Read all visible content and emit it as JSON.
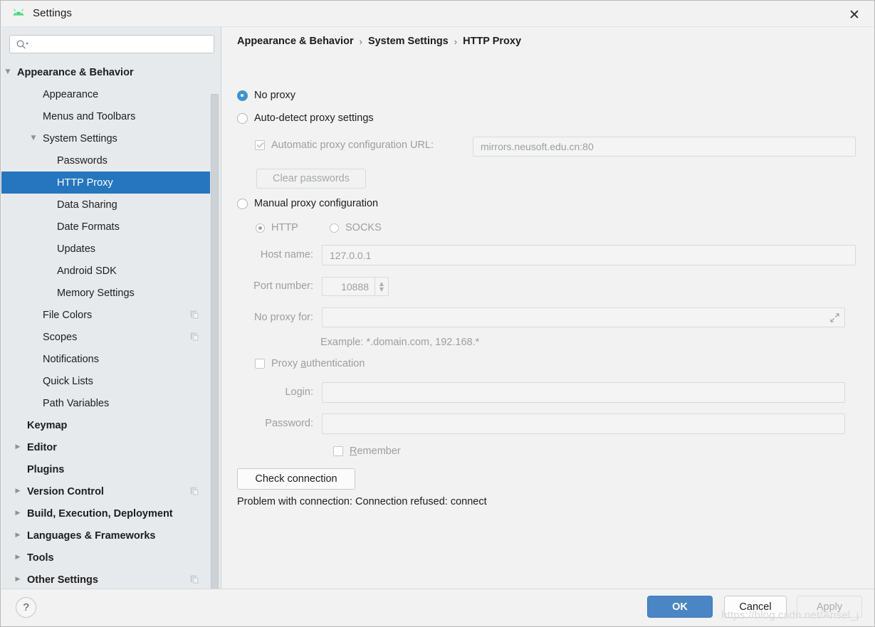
{
  "window": {
    "title": "Settings",
    "app_icon": "android-icon",
    "close_label": "✕"
  },
  "sidebar": {
    "search": {
      "value": "",
      "placeholder": "",
      "icon": "search-icon"
    },
    "items": [
      {
        "label": "Appearance & Behavior",
        "indent": 22,
        "twisty": "▼",
        "bold": true,
        "selected": false,
        "copy_icon": false
      },
      {
        "label": "Appearance",
        "indent": 58,
        "twisty": "",
        "bold": false,
        "selected": false,
        "copy_icon": false
      },
      {
        "label": "Menus and Toolbars",
        "indent": 58,
        "twisty": "",
        "bold": false,
        "selected": false,
        "copy_icon": false
      },
      {
        "label": "System Settings",
        "indent": 58,
        "twisty": "▼",
        "bold": false,
        "selected": false,
        "copy_icon": false
      },
      {
        "label": "Passwords",
        "indent": 78,
        "twisty": "",
        "bold": false,
        "selected": false,
        "copy_icon": false
      },
      {
        "label": "HTTP Proxy",
        "indent": 78,
        "twisty": "",
        "bold": false,
        "selected": true,
        "copy_icon": false
      },
      {
        "label": "Data Sharing",
        "indent": 78,
        "twisty": "",
        "bold": false,
        "selected": false,
        "copy_icon": false
      },
      {
        "label": "Date Formats",
        "indent": 78,
        "twisty": "",
        "bold": false,
        "selected": false,
        "copy_icon": false
      },
      {
        "label": "Updates",
        "indent": 78,
        "twisty": "",
        "bold": false,
        "selected": false,
        "copy_icon": false
      },
      {
        "label": "Android SDK",
        "indent": 78,
        "twisty": "",
        "bold": false,
        "selected": false,
        "copy_icon": false
      },
      {
        "label": "Memory Settings",
        "indent": 78,
        "twisty": "",
        "bold": false,
        "selected": false,
        "copy_icon": false
      },
      {
        "label": "File Colors",
        "indent": 58,
        "twisty": "",
        "bold": false,
        "selected": false,
        "copy_icon": true
      },
      {
        "label": "Scopes",
        "indent": 58,
        "twisty": "",
        "bold": false,
        "selected": false,
        "copy_icon": true
      },
      {
        "label": "Notifications",
        "indent": 58,
        "twisty": "",
        "bold": false,
        "selected": false,
        "copy_icon": false
      },
      {
        "label": "Quick Lists",
        "indent": 58,
        "twisty": "",
        "bold": false,
        "selected": false,
        "copy_icon": false
      },
      {
        "label": "Path Variables",
        "indent": 58,
        "twisty": "",
        "bold": false,
        "selected": false,
        "copy_icon": false
      },
      {
        "label": "Keymap",
        "indent": 36,
        "twisty": "",
        "bold": true,
        "selected": false,
        "copy_icon": false
      },
      {
        "label": "Editor",
        "indent": 36,
        "twisty": "▶",
        "bold": true,
        "selected": false,
        "copy_icon": false
      },
      {
        "label": "Plugins",
        "indent": 36,
        "twisty": "",
        "bold": true,
        "selected": false,
        "copy_icon": false
      },
      {
        "label": "Version Control",
        "indent": 36,
        "twisty": "▶",
        "bold": true,
        "selected": false,
        "copy_icon": true
      },
      {
        "label": "Build, Execution, Deployment",
        "indent": 36,
        "twisty": "▶",
        "bold": true,
        "selected": false,
        "copy_icon": false
      },
      {
        "label": "Languages & Frameworks",
        "indent": 36,
        "twisty": "▶",
        "bold": true,
        "selected": false,
        "copy_icon": false
      },
      {
        "label": "Tools",
        "indent": 36,
        "twisty": "▶",
        "bold": true,
        "selected": false,
        "copy_icon": false
      },
      {
        "label": "Other Settings",
        "indent": 36,
        "twisty": "▶",
        "bold": true,
        "selected": false,
        "copy_icon": true
      }
    ]
  },
  "breadcrumb": {
    "part1": "Appearance & Behavior",
    "sep1": "›",
    "part2": "System Settings",
    "sep2": "›",
    "part3": "HTTP Proxy"
  },
  "proxy": {
    "mode": "no-proxy",
    "no_proxy_label": "No proxy",
    "auto_detect_label": "Auto-detect proxy settings",
    "auto_config_checkbox_label": "Automatic proxy configuration URL:",
    "auto_config_checked": true,
    "auto_config_url": "mirrors.neusoft.edu.cn:80",
    "clear_passwords_label": "Clear passwords",
    "manual_label": "Manual proxy configuration",
    "http_label": "HTTP",
    "socks_label": "SOCKS",
    "protocol_selected": "HTTP",
    "host_label": "Host name:",
    "host_value": "127.0.0.1",
    "port_label": "Port number:",
    "port_value": "10888",
    "spinner_up": "▲",
    "spinner_down": "▼",
    "no_proxy_for_label": "No proxy for:",
    "no_proxy_for_value": "",
    "expand_icon": "expand-icon",
    "example_text": "Example: *.domain.com, 192.168.*",
    "proxy_auth_label_pre": "Proxy ",
    "proxy_auth_label_mnemonic": "a",
    "proxy_auth_label_post": "uthentication",
    "proxy_auth_checked": false,
    "login_label": "Login:",
    "login_value": "",
    "password_label": "Password:",
    "password_value": "",
    "remember_mnemonic": "R",
    "remember_label_post": "emember",
    "remember_checked": false,
    "check_connection_label": "Check connection",
    "problem_text": "Problem with connection: Connection refused: connect"
  },
  "footer": {
    "help_label": "?",
    "ok_label": "OK",
    "cancel_label": "Cancel",
    "apply_label": "Apply",
    "watermark": "https://blog.csdn.net/Ansel_j"
  },
  "colors": {
    "selection_blue": "#2675bf",
    "accent_radio_blue": "#3e92d8",
    "ok_button_blue": "#4a86c5",
    "sidebar_bg": "#e6eaed",
    "panel_bg": "#f2f2f2",
    "android_green": "#3ddc84"
  }
}
